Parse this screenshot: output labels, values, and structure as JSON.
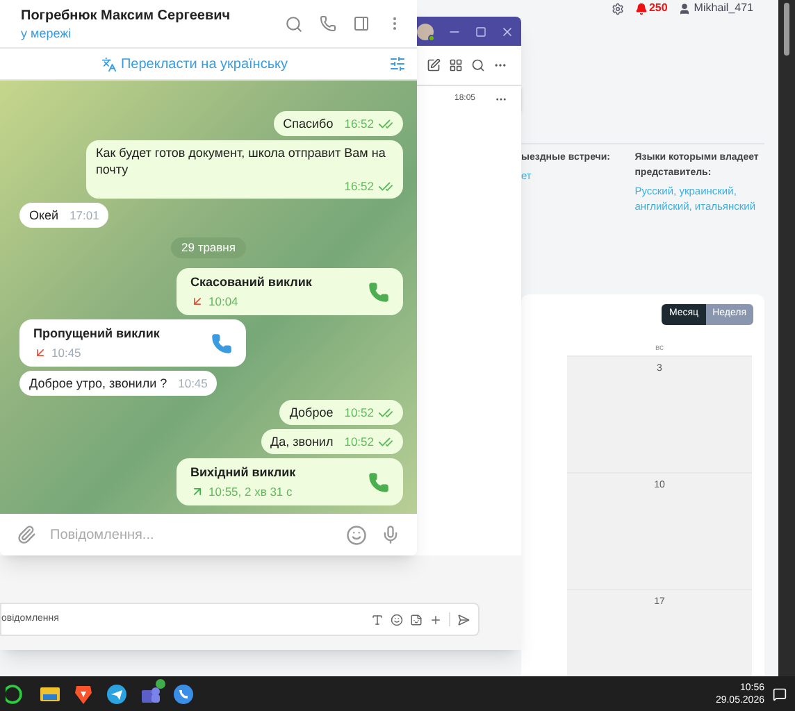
{
  "web_header": {
    "notifications": "250",
    "user": "Mikhail_471"
  },
  "profile": {
    "fields": [
      {
        "label": "ыездные встречи:",
        "value": "ет"
      },
      {
        "label": "Языки которыми владеет представитель:",
        "value": "Русский, украинский, английский, итальянский"
      }
    ]
  },
  "calendar": {
    "views": [
      {
        "label": "Месяц",
        "selected": true
      },
      {
        "label": "Неделя",
        "selected": false
      }
    ],
    "day_header": "вс",
    "days": [
      "3",
      "10",
      "17"
    ]
  },
  "teams": {
    "conversation_time": "18:05",
    "composer": {
      "placeholder": "овідомлення"
    }
  },
  "telegram": {
    "contact": "Погребнюк Максим Сергеевич",
    "status": "у мережі",
    "translate": "Перекласти на українську",
    "messages": [
      {
        "kind": "text",
        "outgoing": true,
        "text": "Спасибо",
        "time": "16:52",
        "read": true
      },
      {
        "kind": "text",
        "outgoing": true,
        "text": "Как будет готов документ, школа отправит Вам на почту",
        "time": "16:52",
        "read": true
      },
      {
        "kind": "text",
        "outgoing": false,
        "text": "Окей",
        "time": "17:01"
      },
      {
        "kind": "date",
        "text": "29 травня"
      },
      {
        "kind": "call",
        "outgoing": true,
        "title": "Скасований виклик",
        "missed": true,
        "time": "10:04"
      },
      {
        "kind": "call",
        "outgoing": false,
        "title": "Пропущений виклик",
        "missed": true,
        "time": "10:45"
      },
      {
        "kind": "text",
        "outgoing": false,
        "text": "Доброе утро, звонили ?",
        "time": "10:45"
      },
      {
        "kind": "text",
        "outgoing": true,
        "text": "Доброе",
        "time": "10:52",
        "read": true
      },
      {
        "kind": "text",
        "outgoing": true,
        "text": "Да, звонил",
        "time": "10:52",
        "read": true
      },
      {
        "kind": "call",
        "outgoing": true,
        "title": "Вихідний виклик",
        "missed": false,
        "time": "10:55, 2 хв 31 с"
      }
    ],
    "input": {
      "placeholder": "Повідомлення..."
    }
  },
  "taskbar": {
    "time": "10:56",
    "date": "29.05.2026"
  }
}
